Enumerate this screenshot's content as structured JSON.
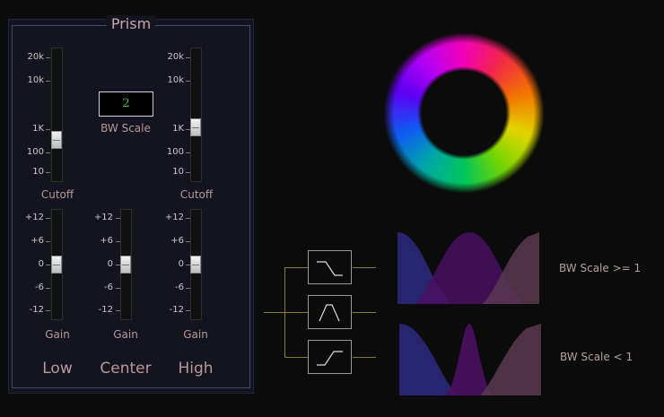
{
  "panel": {
    "title": "Prism",
    "cutoff_scale": [
      "20k",
      "10k",
      "1K",
      "100",
      "10"
    ],
    "gain_scale": [
      "+12",
      "+6",
      "0",
      "-6",
      "-12"
    ],
    "cutoff_label": "Cutoff",
    "gain_label": "Gain",
    "bw_scale_value": "2",
    "bw_scale_label": "BW Scale",
    "bands": [
      "Low",
      "Center",
      "High"
    ]
  },
  "diagram": {
    "bw_ge_label": "BW Scale >= 1",
    "bw_lt_label": "BW Scale < 1"
  },
  "colors": {
    "panel_bg": "#141420",
    "panel_border": "#4a4a62",
    "label": "#b89898",
    "lcd_text": "#3cc23c",
    "wire": "#8a7a38",
    "low_curve": "#2c2a80",
    "center_curve": "#4a1060",
    "high_curve": "#5a3852"
  },
  "controls": {
    "low_cutoff": "1K",
    "high_cutoff": "1K",
    "low_gain": "0",
    "center_gain": "0",
    "high_gain": "0"
  }
}
